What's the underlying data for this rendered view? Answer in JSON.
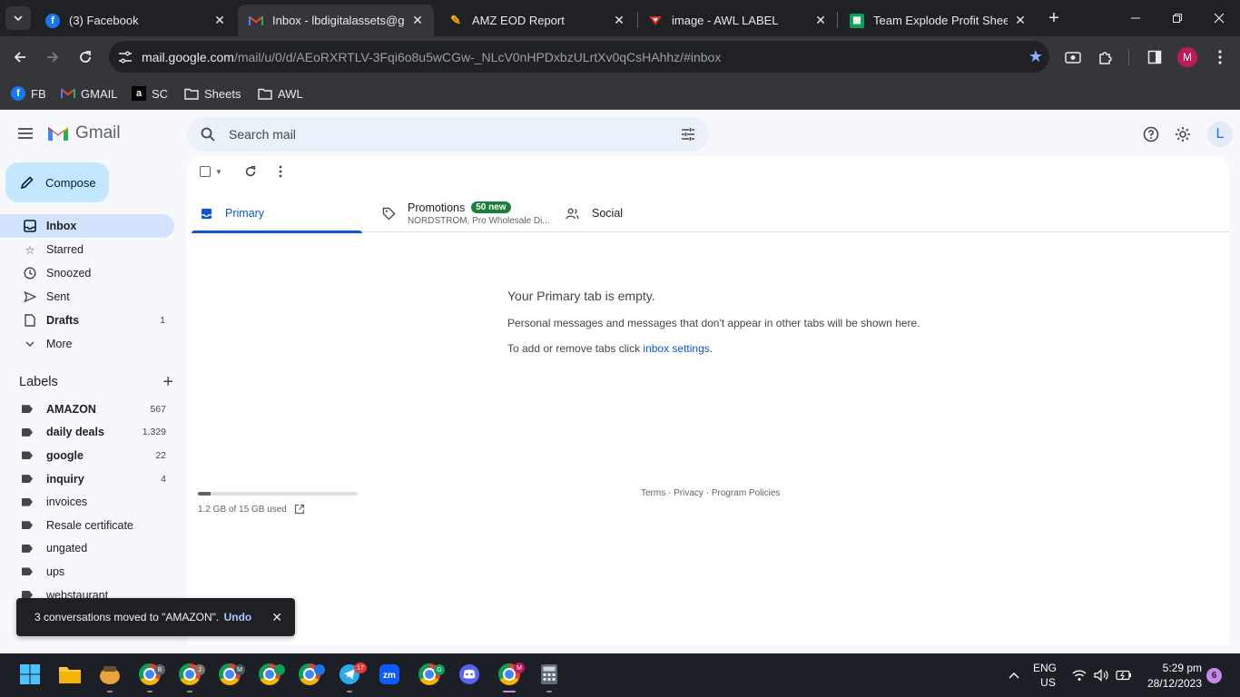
{
  "browser": {
    "tabs": [
      {
        "title": "(3) Facebook",
        "icon": "facebook-icon"
      },
      {
        "title": "Inbox - lbdigitalassets@gmail.com",
        "icon": "gmail-icon"
      },
      {
        "title": "AMZ EOD Report",
        "icon": "pen-icon"
      },
      {
        "title": "image - AWL LABEL",
        "icon": "label-icon"
      },
      {
        "title": "Team Explode Profit Sheet D",
        "icon": "sheets-icon"
      }
    ],
    "url_host": "mail.google.com",
    "url_path": "/mail/u/0/d/AEoRXRTLV-3Fqi6o8u5wCGw-_NLcV0nHPDxbzULrtXv0qCsHAhhz/#inbox",
    "profile_initial": "M",
    "bookmarks": [
      {
        "label": "FB",
        "icon": "facebook-icon"
      },
      {
        "label": "GMAIL",
        "icon": "gmail-icon"
      },
      {
        "label": "SC",
        "icon": "amazon-icon"
      },
      {
        "label": "Sheets",
        "icon": "folder-icon"
      },
      {
        "label": "AWL",
        "icon": "folder-icon"
      }
    ]
  },
  "gmail": {
    "logo_text": "Gmail",
    "search_placeholder": "Search mail",
    "account_initial": "L",
    "compose_label": "Compose",
    "nav": [
      {
        "label": "Inbox",
        "count": "",
        "icon": "inbox-icon"
      },
      {
        "label": "Starred",
        "count": "",
        "icon": "star-icon"
      },
      {
        "label": "Snoozed",
        "count": "",
        "icon": "clock-icon"
      },
      {
        "label": "Sent",
        "count": "",
        "icon": "send-icon"
      },
      {
        "label": "Drafts",
        "count": "1",
        "icon": "draft-icon"
      },
      {
        "label": "More",
        "count": "",
        "icon": "chevron-down-icon"
      }
    ],
    "labels_title": "Labels",
    "labels": [
      {
        "label": "AMAZON",
        "count": "567"
      },
      {
        "label": "daily deals",
        "count": "1,329"
      },
      {
        "label": "google",
        "count": "22"
      },
      {
        "label": "inquiry",
        "count": "4"
      },
      {
        "label": "invoices",
        "count": ""
      },
      {
        "label": "Resale certificate",
        "count": ""
      },
      {
        "label": "ungated",
        "count": ""
      },
      {
        "label": "ups",
        "count": ""
      },
      {
        "label": "webstaurant",
        "count": ""
      }
    ],
    "inbox_tabs": {
      "primary": "Primary",
      "promotions": "Promotions",
      "promotions_badge": "50 new",
      "promotions_snippet": "NORDSTROM, Pro Wholesale Di...",
      "social": "Social"
    },
    "empty": {
      "title": "Your Primary tab is empty.",
      "line1": "Personal messages and messages that don't appear in other tabs will be shown here.",
      "line2_prefix": "To add or remove tabs click ",
      "line2_link": "inbox settings",
      "line2_suffix": "."
    },
    "storage": {
      "text": "1.2 GB of 15 GB used",
      "used_fraction": 0.08
    },
    "footer": {
      "terms": "Terms",
      "privacy": "Privacy",
      "policies": "Program Policies",
      "sep": " · "
    },
    "toast": {
      "message": "3 conversations moved to \"AMAZON\".",
      "undo": "Undo"
    }
  },
  "taskbar": {
    "language": "ENG",
    "region": "US",
    "time": "5:29 pm",
    "date": "28/12/2023",
    "notifications": "6",
    "telegram_badge": "17",
    "chrome_profiles": [
      "B",
      "J",
      "M",
      "",
      "",
      "G",
      "M"
    ]
  }
}
